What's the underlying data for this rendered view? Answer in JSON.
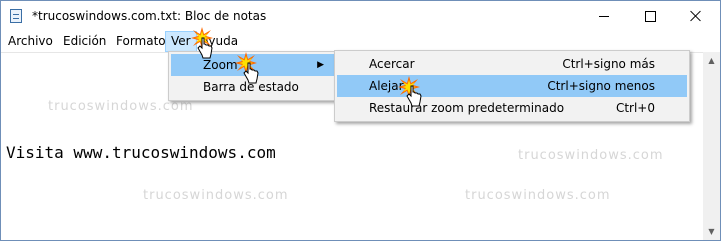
{
  "window": {
    "title": "*trucoswindows.com.txt: Bloc de notas"
  },
  "menubar": {
    "items": [
      "Archivo",
      "Edición",
      "Formato",
      "Ver",
      "Ayuda"
    ],
    "active": "Ver"
  },
  "ver_menu": {
    "items": [
      {
        "label": "Zoom",
        "has_submenu": true,
        "highlighted": true
      },
      {
        "label": "Barra de estado",
        "has_submenu": false,
        "highlighted": false
      }
    ]
  },
  "zoom_menu": {
    "items": [
      {
        "label": "Acercar",
        "shortcut": "Ctrl+signo más",
        "highlighted": false
      },
      {
        "label": "Alejar",
        "shortcut": "Ctrl+signo menos",
        "highlighted": true
      },
      {
        "label": "Restaurar zoom predeterminado",
        "shortcut": "Ctrl+0",
        "highlighted": false
      }
    ]
  },
  "editor": {
    "text": "Visita www.trucoswindows.com"
  },
  "watermark": "trucoswindows.com",
  "icons": {
    "app": "notepad-icon",
    "minimize": "minimize-icon",
    "maximize": "maximize-icon",
    "close": "close-icon",
    "submenu": "chevron-right-icon",
    "click_marker": "click-burst-icon",
    "pointer": "hand-cursor-icon"
  },
  "colors": {
    "menu_highlight": "#91c9f7",
    "menubar_active": "#cce8ff",
    "menu_background": "#f2f2f2",
    "window_border": "#6f8fb8",
    "watermark": "#d6d6d6"
  }
}
